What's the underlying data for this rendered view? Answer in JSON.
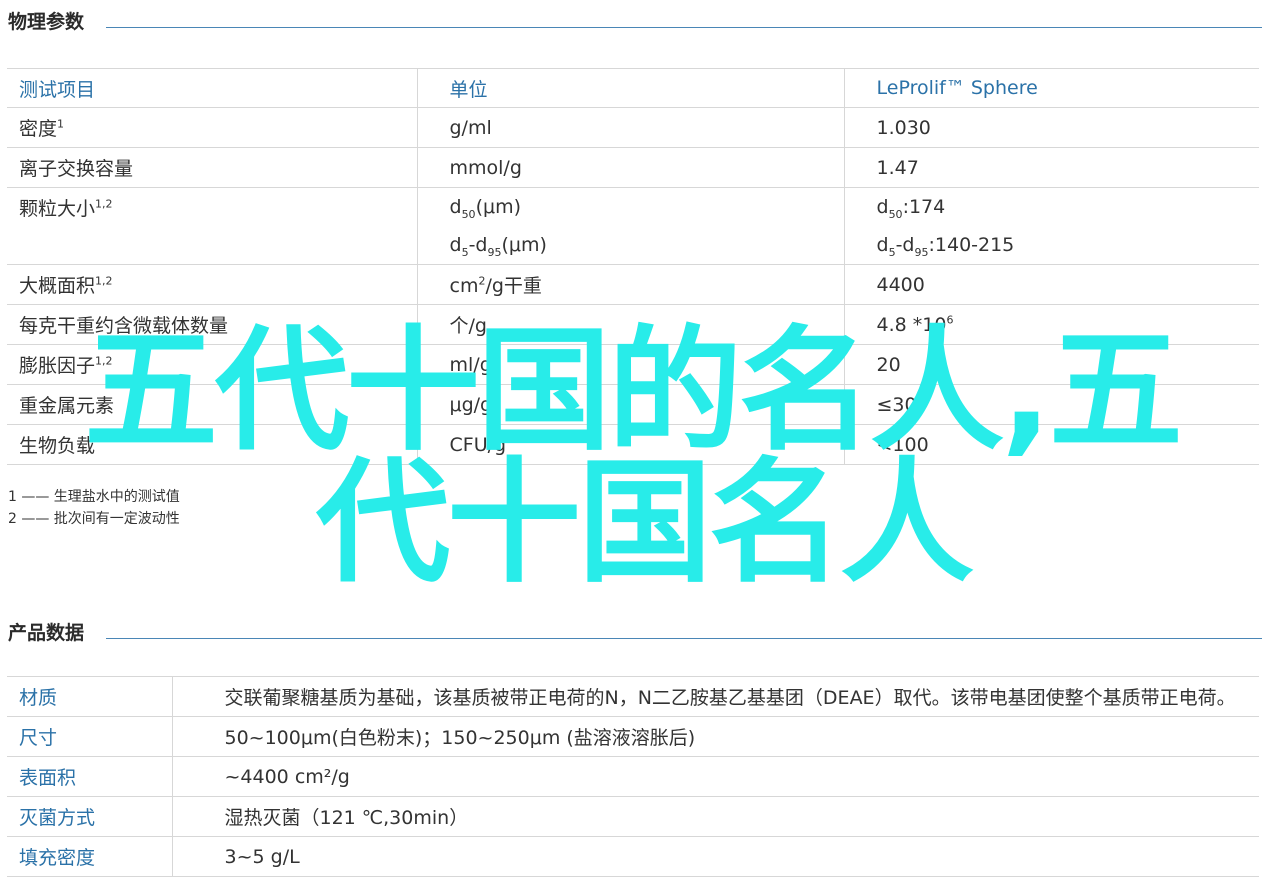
{
  "physical": {
    "section_title": "物理参数",
    "headers": [
      "测试项目",
      "单位",
      "LeProlif™ Sphere"
    ],
    "rows": [
      {
        "item": "密度",
        "sup": "1",
        "unit": "g/ml",
        "value": "1.030"
      },
      {
        "item": "离子交换容量",
        "sup": "",
        "unit": "mmol/g",
        "value": "1.47"
      },
      {
        "item": "颗粒大小",
        "sup": "1,2",
        "unit_a": "d50(μm)",
        "value_a": "d50:174",
        "unit_b": "d5-d95(μm)",
        "value_b": "d5-d95:140-215"
      },
      {
        "item": "大概面积",
        "sup": "1,2",
        "unit": "cm2/g干重",
        "value": "4400"
      },
      {
        "item": "每克干重约含微载体数量",
        "sup": "",
        "unit": "个/g",
        "value": "4.8 *106"
      },
      {
        "item": "膨胀因子",
        "sup": "1,2",
        "unit": "ml/g",
        "value": "20"
      },
      {
        "item": "重金属元素",
        "sup": "",
        "unit": "μg/g",
        "value": "≤30"
      },
      {
        "item": "生物负载",
        "sup": "",
        "unit": "CFU/g",
        "value": "<100"
      }
    ],
    "notes": [
      "1 —— 生理盐水中的测试值",
      "2 —— 批次间有一定波动性"
    ]
  },
  "product": {
    "section_title": "产品数据",
    "rows": [
      {
        "key": "材质",
        "value": "交联葡聚糖基质为基础，该基质被带正电荷的N，N二乙胺基乙基基团（DEAE）取代。该带电基团使整个基质带正电荷。"
      },
      {
        "key": "尺寸",
        "value": "50~100μm(白色粉末)；150~250μm (盐溶液溶胀后)"
      },
      {
        "key": "表面积",
        "value": "~4400 cm²/g"
      },
      {
        "key": "灭菌方式",
        "value": "湿热灭菌（121 ℃,30min）"
      },
      {
        "key": "填充密度",
        "value": "3~5 g/L"
      }
    ]
  },
  "watermark": {
    "line1": "五代十国的名人,五",
    "line2": "代十国名人",
    "color": "#28ece9"
  }
}
